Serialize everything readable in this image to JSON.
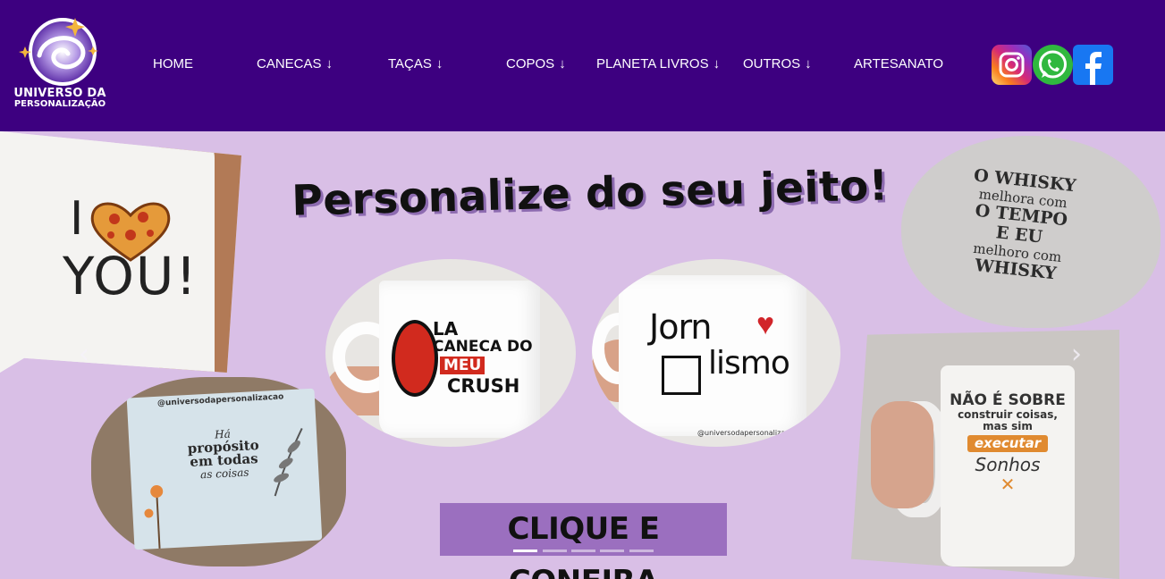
{
  "brand": {
    "name_line1": "UNIVERSO DA",
    "name_line2": "PERSONALIZAÇÃO",
    "header_bg": "#3d0080"
  },
  "nav": {
    "items": [
      {
        "label": "HOME",
        "has_dropdown": false
      },
      {
        "label": "CANECAS",
        "has_dropdown": true,
        "arrow": "↓"
      },
      {
        "label": "TAÇAS",
        "has_dropdown": true,
        "arrow": "↓"
      },
      {
        "label": "COPOS",
        "has_dropdown": true,
        "arrow": "↓"
      },
      {
        "label": "PLANETA LIVROS",
        "has_dropdown": true,
        "arrow": "↓"
      },
      {
        "label": "OUTROS",
        "has_dropdown": true,
        "arrow": "↓"
      },
      {
        "label": "ARTESANATO",
        "has_dropdown": false
      }
    ]
  },
  "social": [
    {
      "icon": "instagram-icon"
    },
    {
      "icon": "whatsapp-icon"
    },
    {
      "icon": "facebook-icon"
    }
  ],
  "banner": {
    "bg": "#d9bfe6",
    "headline": "Personalize do seu jeito!",
    "shirt": {
      "line1": "I",
      "line2": "YOU!"
    },
    "whisky": {
      "line1": "O WHISKY",
      "line2": "melhora com",
      "line3": "O TEMPO",
      "line4": "E EU",
      "line5": "melhoro com",
      "line6": "WHISKY"
    },
    "purpose": {
      "tag": "@universodapersonalizacao",
      "line1": "Há",
      "line2": "propósito",
      "line3": "em todas",
      "line4": "as coisas"
    },
    "mug1": {
      "line1": "LA",
      "line2": "CANECA DO",
      "line3": "MEU",
      "line4": "CRUSH"
    },
    "mug2": {
      "line1": "Jorn",
      "line2": "lismo",
      "tag": "@universodapersonaliza..."
    },
    "beer": {
      "line1": "NÃO É SOBRE",
      "line2": "construir coisas,",
      "line3": "mas sim",
      "line4": "executar",
      "line5": "Sonhos"
    },
    "cta": "CLIQUE E CONFIRA",
    "prev_arrow": "‹",
    "next_arrow": "›",
    "slides": {
      "count": 5,
      "active": 1
    }
  }
}
